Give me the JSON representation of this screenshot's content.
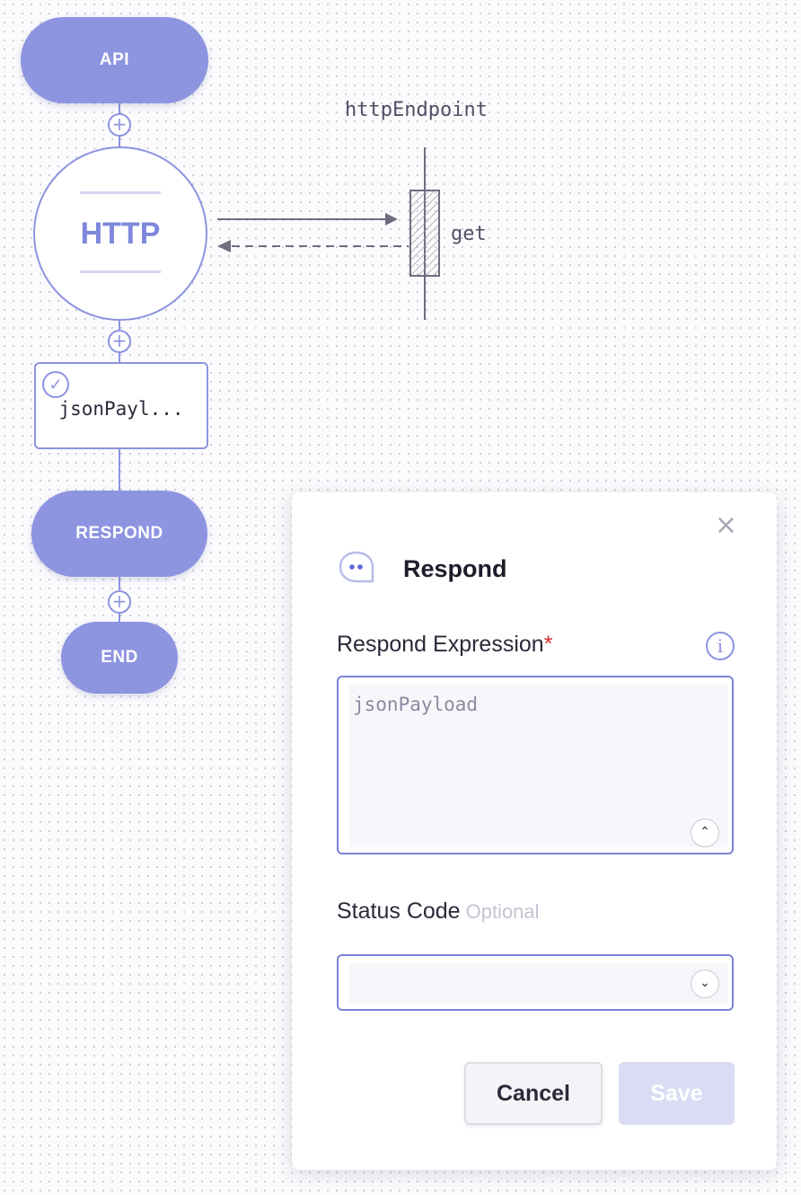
{
  "flow": {
    "api_label": "API",
    "http_label": "HTTP",
    "json_node_label": "jsonPayl...",
    "respond_label": "RESPOND",
    "end_label": "END",
    "plus_symbol": "+",
    "check_symbol": "✓",
    "endpoint_name": "httpEndpoint",
    "endpoint_method": "get"
  },
  "panel": {
    "title": "Respond",
    "close_symbol": "×",
    "respond_expression": {
      "label": "Respond Expression",
      "required_mark": "*",
      "info_symbol": "i",
      "value": "jsonPayload",
      "collapse_symbol": "⌃"
    },
    "status_code": {
      "label": "Status Code",
      "optional_text": "Optional",
      "value": "",
      "dropdown_symbol": "⌄"
    },
    "buttons": {
      "cancel": "Cancel",
      "save": "Save"
    }
  },
  "colors": {
    "node_fill": "#8d94e0",
    "accent": "#7c83d6",
    "save_disabled": "#d9dcf2",
    "required": "#d32f2f"
  },
  "icons": [
    "plus-icon",
    "check-icon",
    "close-icon",
    "respond-icon",
    "info-icon",
    "chevron-up-icon",
    "chevron-down-icon"
  ]
}
